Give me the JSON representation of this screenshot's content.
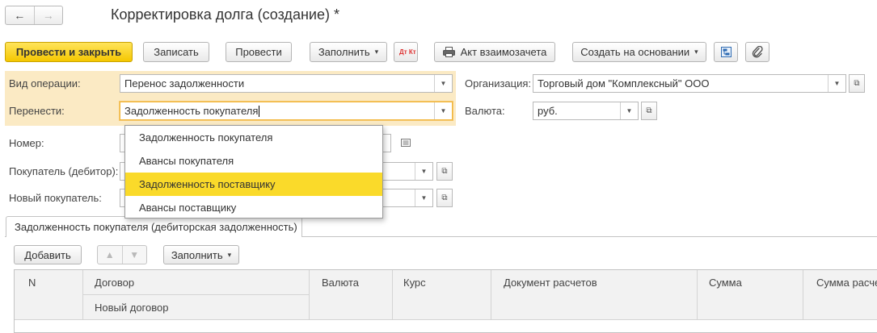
{
  "window": {
    "title": "Корректировка долга (создание) *"
  },
  "nav": {
    "back": "←",
    "forward": "→"
  },
  "toolbar": {
    "post_close": "Провести и закрыть",
    "write": "Записать",
    "post": "Провести",
    "fill": "Заполнить",
    "dt_kt": "Дт Кт",
    "act": "Акт взаимозачета",
    "create_based": "Создать на основании"
  },
  "form": {
    "operation_type": {
      "label": "Вид операции:",
      "value": "Перенос задолженности"
    },
    "transfer": {
      "label": "Перенести:",
      "value": "Задолженность покупателя"
    },
    "number": {
      "label": "Номер:"
    },
    "buyer": {
      "label": "Покупатель (дебитор):"
    },
    "new_buyer": {
      "label": "Новый покупатель:"
    },
    "organization": {
      "label": "Организация:",
      "value": "Торговый дом \"Комплексный\" ООО"
    },
    "currency": {
      "label": "Валюта:",
      "value": "руб."
    }
  },
  "dropdown": {
    "items": [
      {
        "label": "Задолженность покупателя",
        "selected": false
      },
      {
        "label": "Авансы покупателя",
        "selected": false
      },
      {
        "label": "Задолженность поставщику",
        "selected": true
      },
      {
        "label": "Авансы поставщику",
        "selected": false
      }
    ]
  },
  "tabs": [
    {
      "label": "Задолженность покупателя (дебиторская задолженность)"
    }
  ],
  "table_toolbar": {
    "add": "Добавить",
    "fill": "Заполнить"
  },
  "table": {
    "columns": {
      "n": "N",
      "contract": "Договор",
      "new_contract": "Новый договор",
      "currency": "Валюта",
      "rate": "Курс",
      "settlement_doc": "Документ расчетов",
      "amount": "Сумма",
      "amount_settle": "Сумма расче"
    }
  },
  "colors": {
    "primary": "#f5c700",
    "highlight": "#fbeac4",
    "selected": "#fada2a"
  }
}
